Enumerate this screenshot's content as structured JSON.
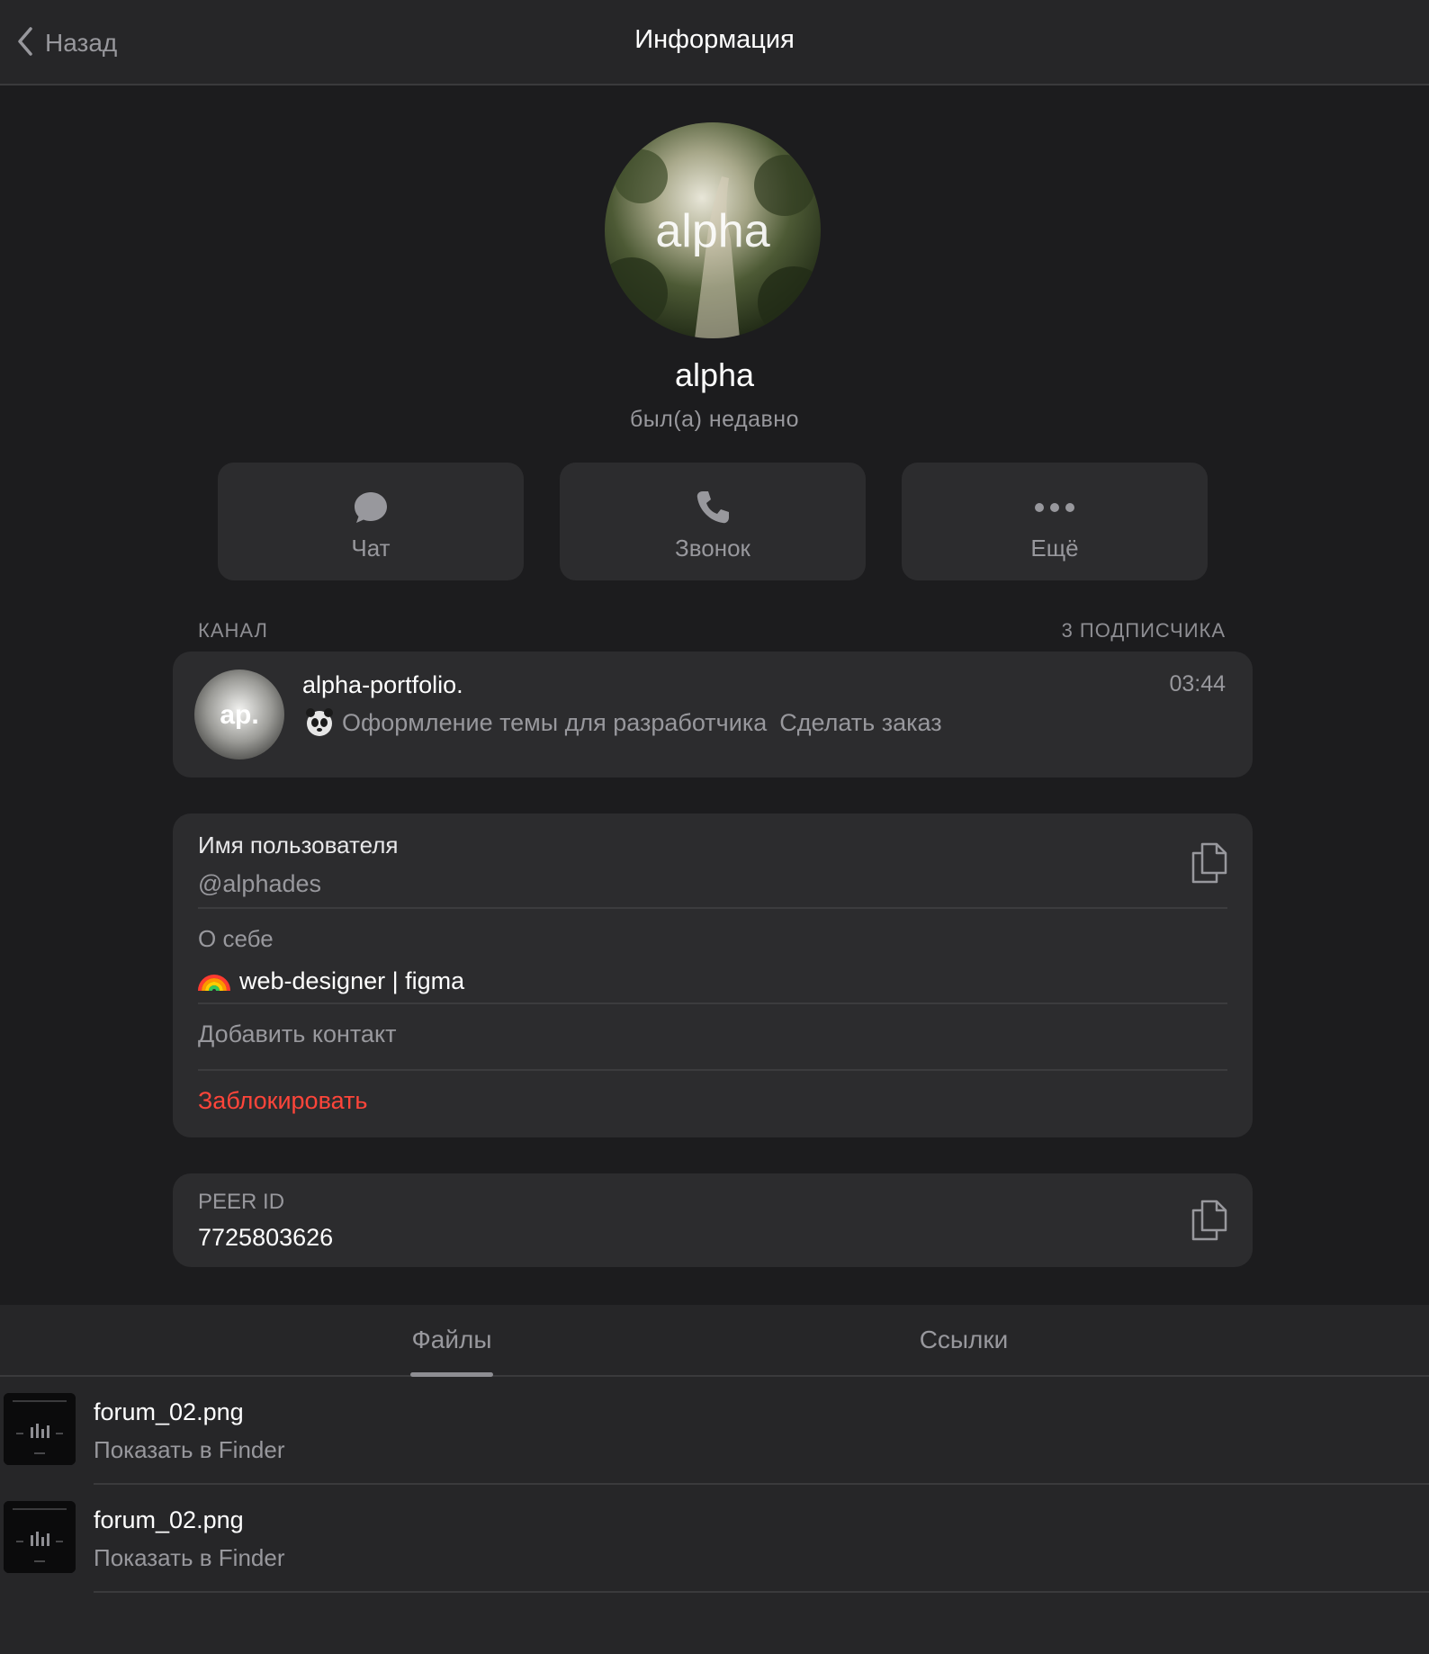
{
  "header": {
    "back_label": "Назад",
    "title": "Информация"
  },
  "profile": {
    "name": "alpha",
    "status": "был(а) недавно",
    "avatar_text": "alpha"
  },
  "actions": [
    {
      "label": "Чат",
      "icon": "chat-bubble-icon"
    },
    {
      "label": "Звонок",
      "icon": "phone-icon"
    },
    {
      "label": "Ещё",
      "icon": "more-dots-icon"
    }
  ],
  "channel": {
    "section_label": "КАНАЛ",
    "subscribers": "3 ПОДПИСЧИКА",
    "name": "alpha-portfolio.",
    "time": "03:44",
    "preview_text": "Оформление темы для разработчика",
    "preview_action": "Сделать заказ",
    "avatar_text": "ap."
  },
  "info": {
    "username_title": "Имя пользователя",
    "username_value": "@alphades",
    "bio_title": "О себе",
    "bio_value": "web-designer | figma",
    "bio_emoji": "🌈",
    "add_contact": "Добавить контакт",
    "block": "Заблокировать"
  },
  "peer": {
    "title": "PEER ID",
    "value": "7725803626"
  },
  "tabs": [
    {
      "label": "Файлы",
      "active": true
    },
    {
      "label": "Ссылки",
      "active": false
    }
  ],
  "files": [
    {
      "name": "forum_02.png",
      "action": "Показать в Finder"
    },
    {
      "name": "forum_02.png",
      "action": "Показать в Finder"
    }
  ],
  "colors": {
    "background": "#1c1c1e",
    "card": "#2c2c2e",
    "danger": "#ff453a",
    "secondary_text": "#98989d"
  }
}
